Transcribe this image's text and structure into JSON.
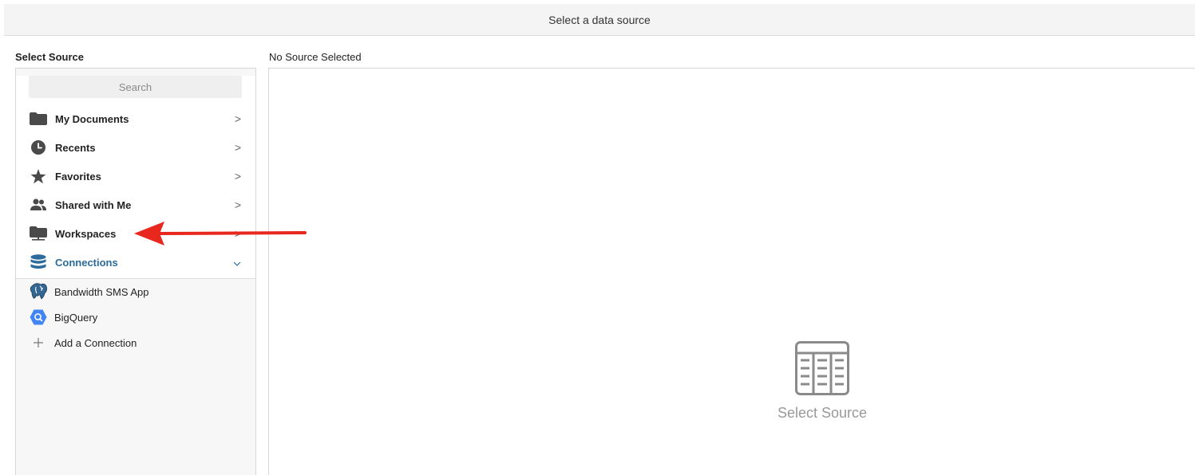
{
  "header": {
    "title": "Select a data source"
  },
  "left_panel": {
    "heading": "Select Source",
    "search": {
      "placeholder": "Search"
    },
    "nav_items": [
      {
        "label": "My Documents",
        "icon": "folder-icon",
        "indicator": ">"
      },
      {
        "label": "Recents",
        "icon": "clock-icon",
        "indicator": ">"
      },
      {
        "label": "Favorites",
        "icon": "star-icon",
        "indicator": ">"
      },
      {
        "label": "Shared with Me",
        "icon": "users-icon",
        "indicator": ">"
      },
      {
        "label": "Workspaces",
        "icon": "workspace-icon",
        "indicator": ">"
      },
      {
        "label": "Connections",
        "icon": "database-icon",
        "indicator": "v",
        "active": true
      }
    ],
    "connections": [
      {
        "label": "Bandwidth SMS App",
        "icon": "postgres-elephant-icon"
      },
      {
        "label": "BigQuery",
        "icon": "bigquery-icon"
      },
      {
        "label": "Add a Connection",
        "icon": "plus-icon"
      }
    ]
  },
  "right_panel": {
    "heading": "No Source Selected",
    "empty_state": {
      "label": "Select Source",
      "icon": "table-icon"
    }
  },
  "colors": {
    "active_accent": "#2b6a9c",
    "annotation_arrow": "#e8271e",
    "bigquery_blue": "#4285f4"
  }
}
